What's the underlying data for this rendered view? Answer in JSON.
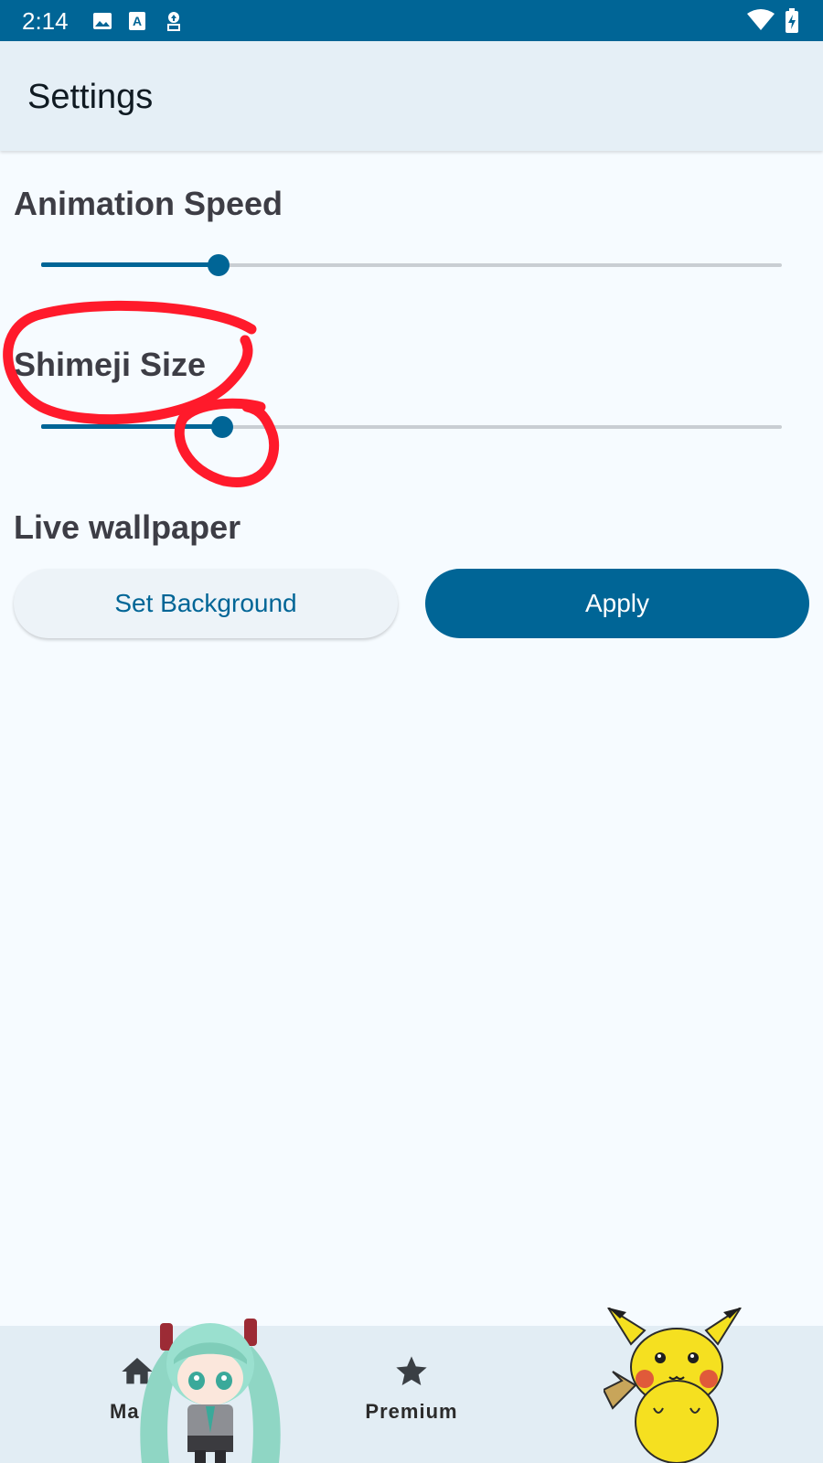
{
  "status_bar": {
    "time": "2:14",
    "left_icons": [
      "image-icon",
      "a-letter-icon",
      "upload-icon"
    ],
    "right_icons": [
      "wifi-icon",
      "battery-icon"
    ]
  },
  "app_bar": {
    "title": "Settings"
  },
  "settings": {
    "animation_speed": {
      "label": "Animation Speed",
      "value_fraction": 0.24
    },
    "shimeji_size": {
      "label": "Shimeji Size",
      "value_fraction": 0.245
    },
    "live_wallpaper": {
      "label": "Live wallpaper",
      "set_background_label": "Set Background",
      "apply_label": "Apply"
    }
  },
  "bottom_nav": {
    "items": [
      {
        "label": "Ma",
        "icon": "home-icon"
      },
      {
        "label": "Premium",
        "icon": "star-icon"
      }
    ]
  },
  "overlays": [
    "miku-sticker",
    "pikachu-sticker",
    "red-circle-annotation"
  ],
  "colors": {
    "primary": "#006596",
    "background": "#f6fbff",
    "annotation": "#ff1a2b"
  }
}
